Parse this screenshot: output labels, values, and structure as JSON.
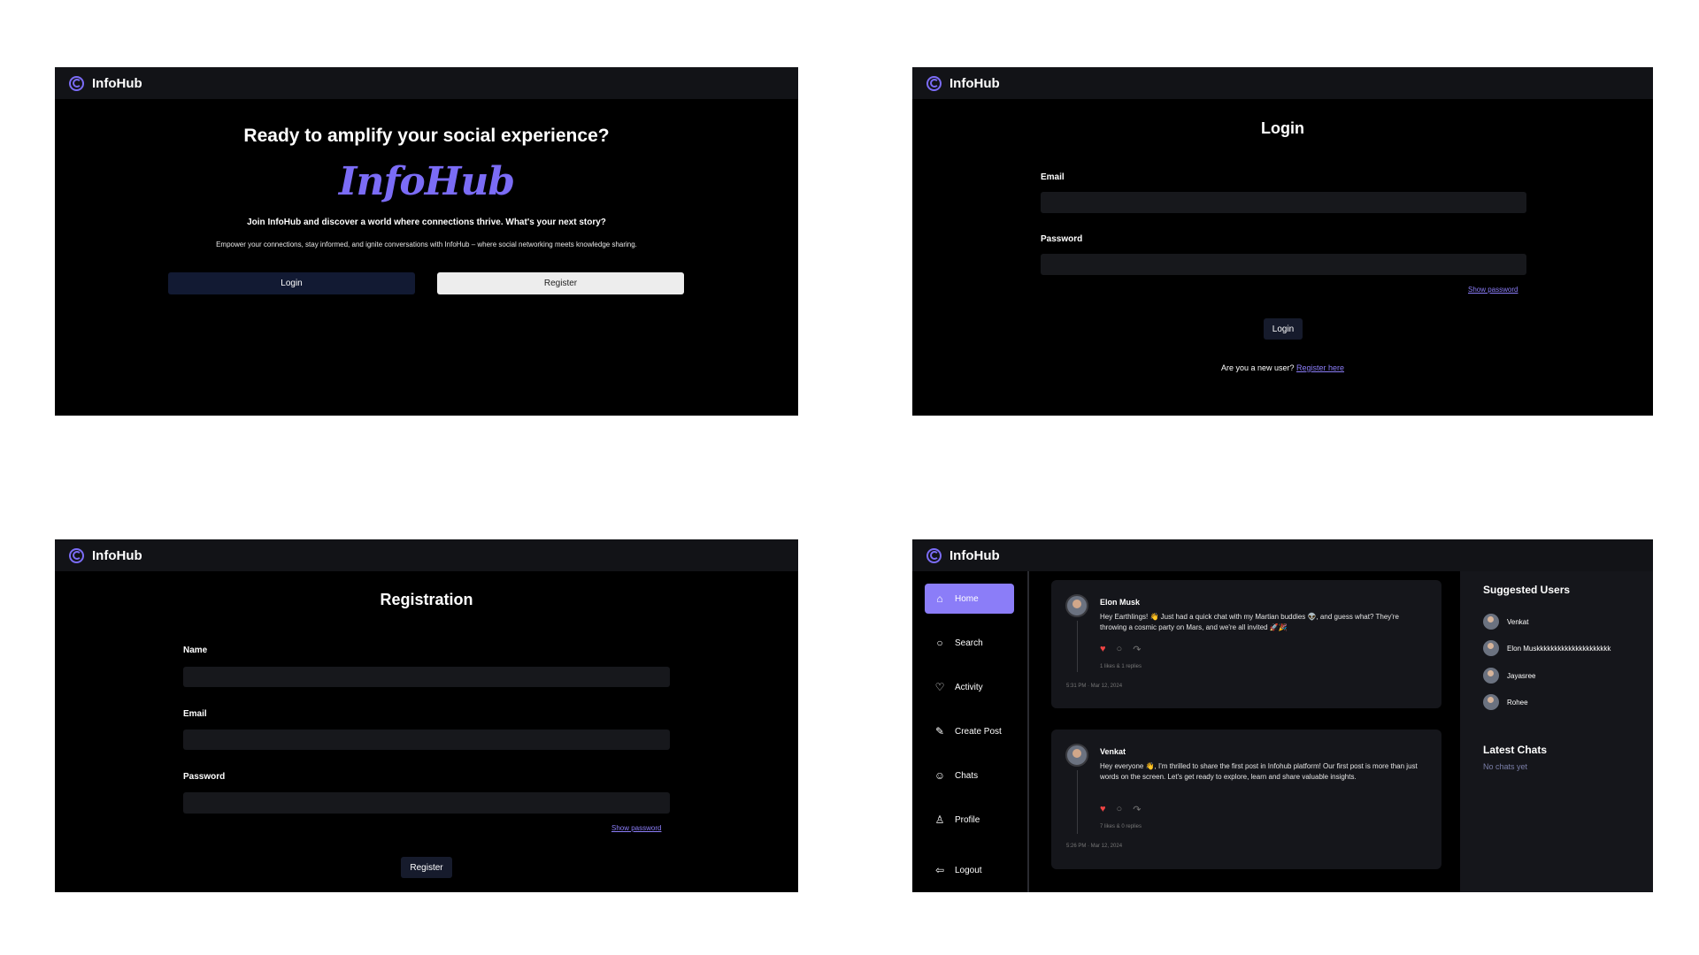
{
  "brand": "InfoHub",
  "colors": {
    "accent": "#7b6cf6",
    "panel_bg": "#000000",
    "topbar_bg": "#121317",
    "like": "#ef4444"
  },
  "landing": {
    "title": "Ready to amplify your social experience?",
    "script_logo": "InfoHub",
    "subtitle": "Join InfoHub and discover a world where connections thrive. What's your next story?",
    "description": "Empower your connections, stay informed, and ignite conversations with InfoHub – where social networking meets knowledge sharing.",
    "login_label": "Login",
    "register_label": "Register"
  },
  "login": {
    "title": "Login",
    "email_label": "Email",
    "password_label": "Password",
    "show_password": "Show password",
    "button": "Login",
    "new_user_text": "Are you a new user?",
    "register_link": "Register here"
  },
  "registration": {
    "title": "Registration",
    "name_label": "Name",
    "email_label": "Email",
    "password_label": "Password",
    "show_password": "Show password",
    "button": "Register"
  },
  "home": {
    "nav": [
      "Home",
      "Search",
      "Activity",
      "Create Post",
      "Chats",
      "Profile",
      "Logout"
    ],
    "nav_icons": [
      "home-icon",
      "search-icon",
      "heart-icon",
      "create-post-icon",
      "chats-icon",
      "profile-icon",
      "logout-icon"
    ],
    "posts": [
      {
        "author": "Elon Musk",
        "text": "Hey Earthlings! 👋 Just had a quick chat with my Martian buddies 👽, and guess what? They're throwing a cosmic party on Mars, and we're all invited 🚀🎉",
        "stats": "1 likes & 1 replies",
        "time": "5:31 PM · Mar 12, 2024"
      },
      {
        "author": "Venkat",
        "text": "Hey everyone 👋, I'm thrilled to share the first post in Infohub platform! Our first post is more than just words on the screen. Let's get ready to explore, learn and share valuable insights.",
        "stats": "7 likes & 0 replies",
        "time": "5:26 PM · Mar 12, 2024"
      }
    ],
    "suggested_title": "Suggested Users",
    "suggested_users": [
      "Venkat",
      "Elon Muskkkkkkkkkkkkkkkkkkkkk",
      "Jayasree",
      "Rohee"
    ],
    "latest_chats_title": "Latest Chats",
    "no_chats": "No chats yet"
  }
}
